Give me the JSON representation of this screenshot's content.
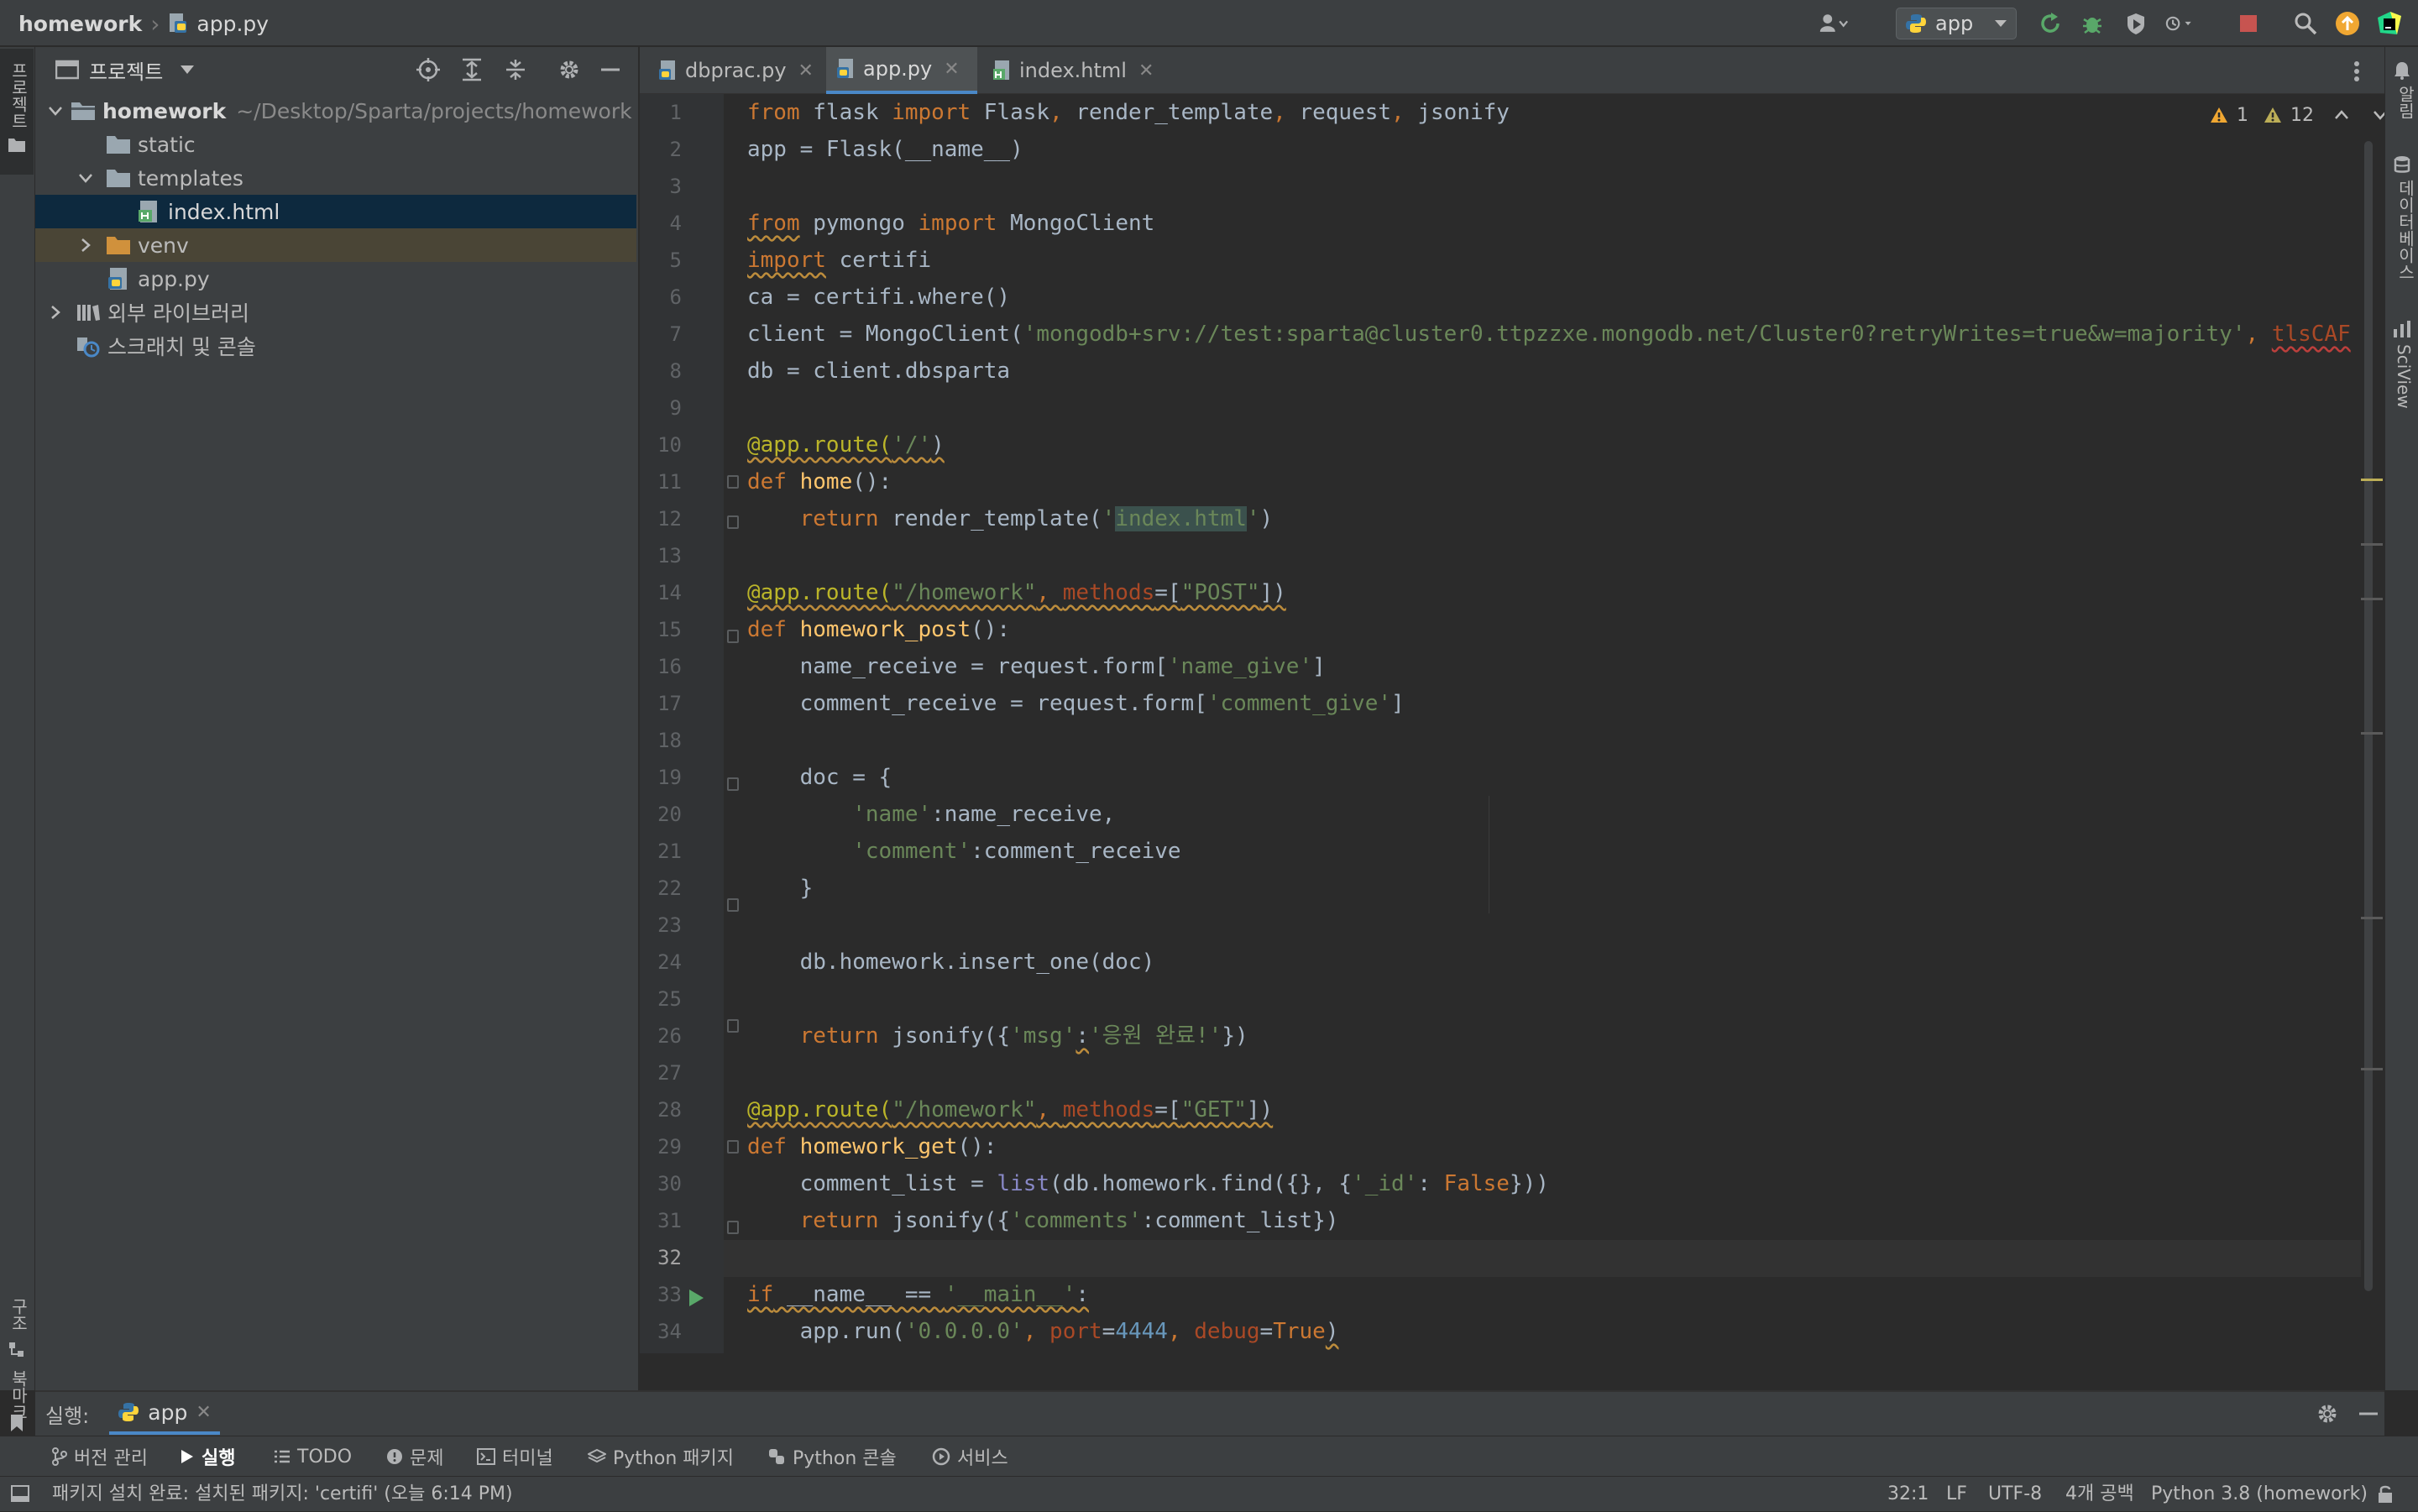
{
  "breadcrumb": {
    "project": "homework",
    "file": "app.py"
  },
  "run_config": {
    "label": "app"
  },
  "left_stripe": {
    "project": "프로젝트",
    "structure": "구조",
    "bookmarks": "북마크"
  },
  "right_stripe": {
    "notifications": "알림",
    "database": "데이터베이스",
    "sciview": "SciView"
  },
  "project_panel": {
    "title": "프로젝트",
    "root": {
      "name": "homework",
      "path": "~/Desktop/Sparta/projects/homework"
    },
    "items": {
      "static": "static",
      "templates": "templates",
      "index_html": "index.html",
      "venv": "venv",
      "app_py": "app.py",
      "ext_libs": "외부 라이브러리",
      "scratches": "스크래치 및 콘솔"
    }
  },
  "tabs": [
    {
      "label": "dbprac.py"
    },
    {
      "label": "app.py",
      "active": true
    },
    {
      "label": "index.html"
    }
  ],
  "inspections": {
    "errors": "1",
    "warnings": "12"
  },
  "editor": {
    "cursor_line": 32,
    "line_numbers": [
      "1",
      "2",
      "3",
      "4",
      "5",
      "6",
      "7",
      "8",
      "9",
      "10",
      "11",
      "12",
      "13",
      "14",
      "15",
      "16",
      "17",
      "18",
      "19",
      "20",
      "21",
      "22",
      "23",
      "24",
      "25",
      "26",
      "27",
      "28",
      "29",
      "30",
      "31",
      "32",
      "33",
      "34"
    ],
    "code": {
      "l1": [
        "from",
        " flask ",
        "import",
        " Flask",
        ",",
        " render_template",
        ",",
        " request",
        ",",
        " jsonify"
      ],
      "l2": "app = Flask(__name__)",
      "l4": [
        "from",
        " pymongo ",
        "import",
        " MongoClient"
      ],
      "l5": [
        "import",
        " certifi"
      ],
      "l6": "ca = certifi.where()",
      "l7": [
        "client = MongoClient(",
        "'mongodb+srv://test:sparta@cluster0.ttpzzxe.mongodb.net/Cluster0?retryWrites=true&w=majority'",
        ", ",
        "tlsCAF"
      ],
      "l8": "db = client.dbsparta",
      "l10": [
        "@app.route(",
        "'/'",
        ")"
      ],
      "l11": [
        "def",
        " ",
        "home",
        "():"
      ],
      "l12": [
        "    ",
        "return",
        " render_template(",
        "'",
        "index.html",
        "'",
        ")"
      ],
      "l14": [
        "@app.route(",
        "\"/homework\"",
        ", ",
        "methods",
        "=[",
        "\"POST\"",
        "])"
      ],
      "l15": [
        "def",
        " ",
        "homework_post",
        "():"
      ],
      "l16": [
        "    name_receive = request.form[",
        "'name_give'",
        "]"
      ],
      "l17": [
        "    comment_receive = request.form[",
        "'comment_give'",
        "]"
      ],
      "l19": "    doc = {",
      "l20": [
        "        ",
        "'name'",
        ":name_receive,"
      ],
      "l21": [
        "        ",
        "'comment'",
        ":comment_receive"
      ],
      "l22": "    }",
      "l24": "    db.homework.insert_one(doc)",
      "l26": [
        "    ",
        "return",
        " jsonify({",
        "'msg'",
        ":",
        "'응원 완료!'",
        "})"
      ],
      "l28": [
        "@app.route(",
        "\"/homework\"",
        ", ",
        "methods",
        "=[",
        "\"GET\"",
        "])"
      ],
      "l29": [
        "def",
        " ",
        "homework_get",
        "():"
      ],
      "l30": [
        "    comment_list = ",
        "list",
        "(db.homework.find({}, {",
        "'_id'",
        ": ",
        "False",
        "}))"
      ],
      "l31": [
        "    ",
        "return",
        " jsonify({",
        "'comments'",
        ":comment_list})"
      ],
      "l33": [
        "if",
        " __name__ == ",
        "'__main__'",
        ":"
      ],
      "l34": [
        "    app.run(",
        "'0.0.0.0'",
        ", ",
        "port",
        "=",
        "4444",
        ", ",
        "debug",
        "=",
        "True",
        ")"
      ]
    }
  },
  "run_panel": {
    "label": "실행:",
    "tab": "app"
  },
  "tool_windows": [
    "버전 관리",
    "실행",
    "TODO",
    "문제",
    "터미널",
    "Python 패키지",
    "Python 콘솔",
    "서비스"
  ],
  "status_bar": {
    "message": "패키지 설치 완료: 설치된 패키지: 'certifi' (오늘 6:14 PM)",
    "position": "32:1",
    "line_sep": "LF",
    "encoding": "UTF-8",
    "indent": "4개 공백",
    "interpreter": "Python 3.8 (homework)"
  },
  "colors": {
    "accent": "#4a88c7",
    "keyword": "#cc7832",
    "string": "#6a8759",
    "decorator": "#bbb529",
    "function": "#ffc66d",
    "number": "#6897bb"
  }
}
